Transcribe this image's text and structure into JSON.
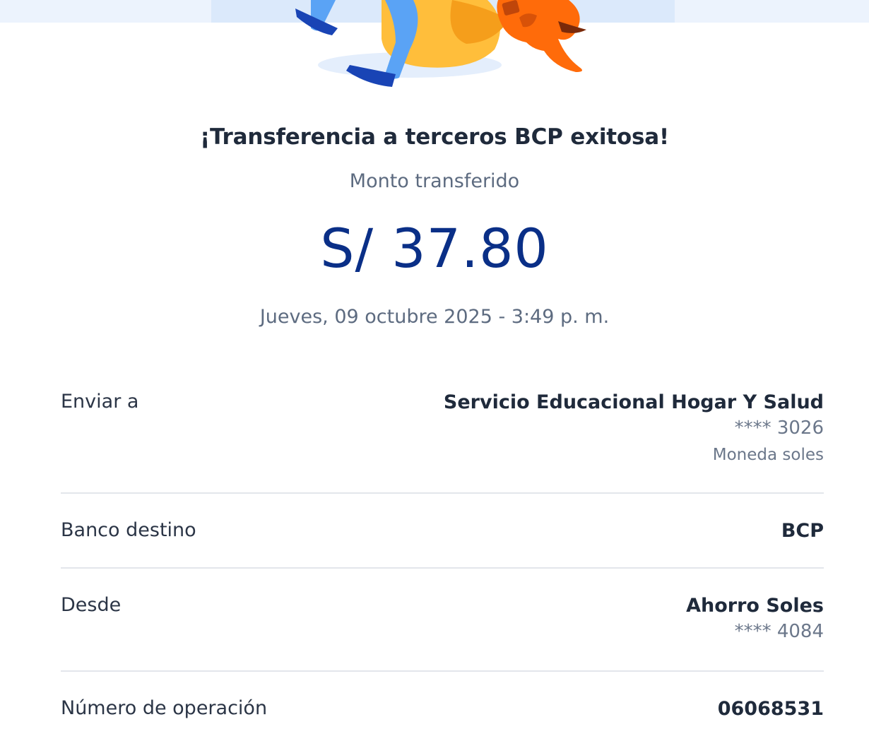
{
  "confirmation": {
    "title": "¡Transferencia a terceros BCP exitosa!",
    "amount_label": "Monto transferido",
    "amount": "S/ 37.80",
    "datetime": "Jueves, 09 octubre 2025 - 3:49 p. m."
  },
  "details": {
    "send_to": {
      "label": "Enviar a",
      "name": "Servicio Educacional Hogar Y Salud",
      "account": "**** 3026",
      "currency": "Moneda soles"
    },
    "dest_bank": {
      "label": "Banco destino",
      "value": "BCP"
    },
    "from": {
      "label": "Desde",
      "name": "Ahorro Soles",
      "account": "**** 4084"
    },
    "operation": {
      "label": "Número de operación",
      "value": "06068531"
    }
  },
  "colors": {
    "amount": "#0a2f87",
    "title": "#1f2a3b",
    "muted": "#5d6b80",
    "divider": "#e3e6eb",
    "header_band": "#ecf3fd"
  },
  "illustration": {
    "icon": "success-illustration"
  }
}
